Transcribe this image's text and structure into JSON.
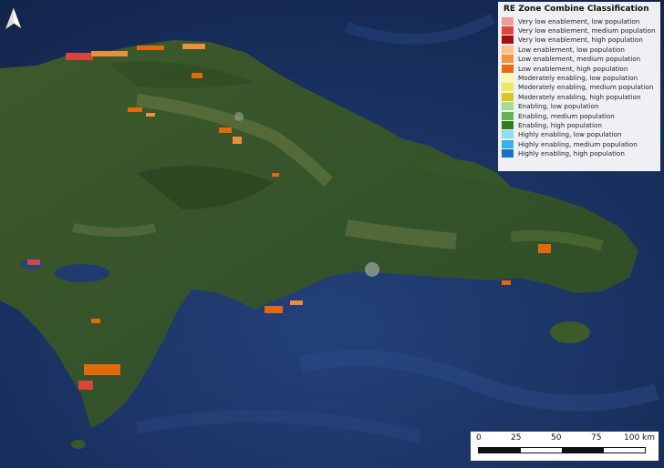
{
  "map": {
    "north_arrow": "north-arrow-icon",
    "legend": {
      "title": "RE Zone Combine Classification",
      "items": [
        {
          "label": "Very low enablement, low population",
          "color": "#f39a9a"
        },
        {
          "label": "Very low enablement, medium population",
          "color": "#e0463c"
        },
        {
          "label": "Very low enablement, high population",
          "color": "#a50f0f"
        },
        {
          "label": "Low enablement, low population",
          "color": "#fbc28a"
        },
        {
          "label": "Low enablement, medium population",
          "color": "#f7913b"
        },
        {
          "label": "Low enablement, high population",
          "color": "#ee6a0b"
        },
        {
          "label": "Moderately enabling, low population",
          "color": "#fbf7b0"
        },
        {
          "label": "Moderately enabling, medium population",
          "color": "#eee85d"
        },
        {
          "label": "Moderately enabling, high population",
          "color": "#d7c917"
        },
        {
          "label": "Enabling, low population",
          "color": "#a5db8e"
        },
        {
          "label": "Enabling, medium population",
          "color": "#63b34f"
        },
        {
          "label": "Enabling, high population",
          "color": "#2f7d1d"
        },
        {
          "label": "Highly enabling, low population",
          "color": "#8fdcf7"
        },
        {
          "label": "Highly enabling, medium population",
          "color": "#3bb0e6"
        },
        {
          "label": "Highly enabling, high population",
          "color": "#1e6fc8"
        }
      ]
    },
    "scale": {
      "ticks": [
        "0",
        "25",
        "50",
        "75",
        "100 km"
      ]
    }
  }
}
